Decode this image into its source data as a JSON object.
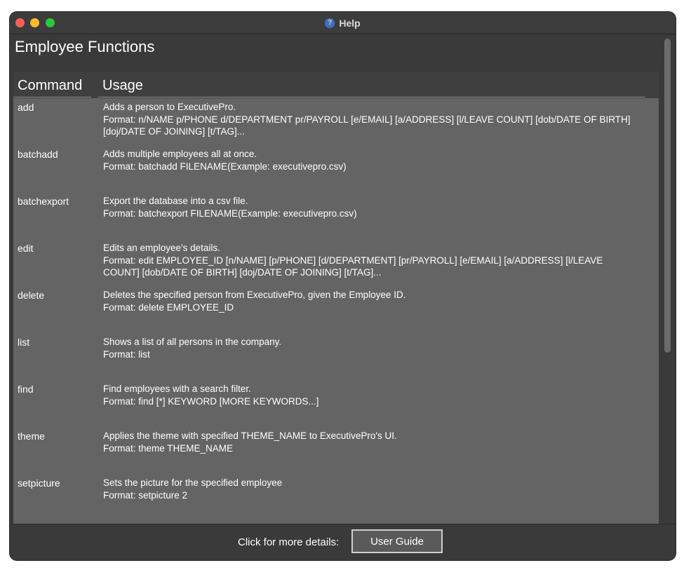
{
  "window": {
    "title": "Help",
    "title_icon": "help-question-icon"
  },
  "heading": "Employee Functions",
  "table": {
    "headers": {
      "command": "Command",
      "usage": "Usage"
    },
    "rows": [
      {
        "command": "add",
        "usage": [
          "Adds a person to ExecutivePro.",
          "Format: n/NAME p/PHONE d/DEPARTMENT pr/PAYROLL [e/EMAIL] [a/ADDRESS] [l/LEAVE COUNT] [dob/DATE OF BIRTH]",
          "[doj/DATE OF JOINING] [t/TAG]..."
        ]
      },
      {
        "command": "batchadd",
        "usage": [
          "Adds multiple employees all at once.",
          "Format: batchadd FILENAME(Example: executivepro.csv)",
          ""
        ]
      },
      {
        "command": "batchexport",
        "usage": [
          "Export the database into a csv file.",
          "Format: batchexport FILENAME(Example: executivepro.csv)",
          ""
        ]
      },
      {
        "command": "edit",
        "usage": [
          "Edits an employee's details.",
          "Format: edit EMPLOYEE_ID [n/NAME] [p/PHONE] [d/DEPARTMENT] [pr/PAYROLL] [e/EMAIL] [a/ADDRESS] [l/LEAVE",
          "COUNT] [dob/DATE OF BIRTH] [doj/DATE OF JOINING] [t/TAG]..."
        ]
      },
      {
        "command": "delete",
        "usage": [
          "Deletes the specified person from ExecutivePro, given the Employee ID.",
          "Format: delete EMPLOYEE_ID",
          ""
        ]
      },
      {
        "command": "list",
        "usage": [
          "Shows a list of all persons in the company.",
          "Format: list",
          ""
        ]
      },
      {
        "command": "find",
        "usage": [
          "Find employees with a search filter.",
          "Format: find [*] KEYWORD [MORE KEYWORDS...]",
          ""
        ]
      },
      {
        "command": "theme",
        "usage": [
          "Applies the theme with specified THEME_NAME to ExecutivePro's UI.",
          "Format: theme THEME_NAME",
          ""
        ]
      },
      {
        "command": "setpicture",
        "usage": [
          "Sets the picture for the specified employee",
          "Format: setpicture 2",
          ""
        ]
      }
    ]
  },
  "footer": {
    "label": "Click for more details:",
    "button": "User Guide"
  },
  "colors": {
    "window_bg": "#3a3a3a",
    "table_bg": "#646464",
    "close": "#ff5f57",
    "minimize": "#febc2e",
    "maximize": "#28c840"
  }
}
